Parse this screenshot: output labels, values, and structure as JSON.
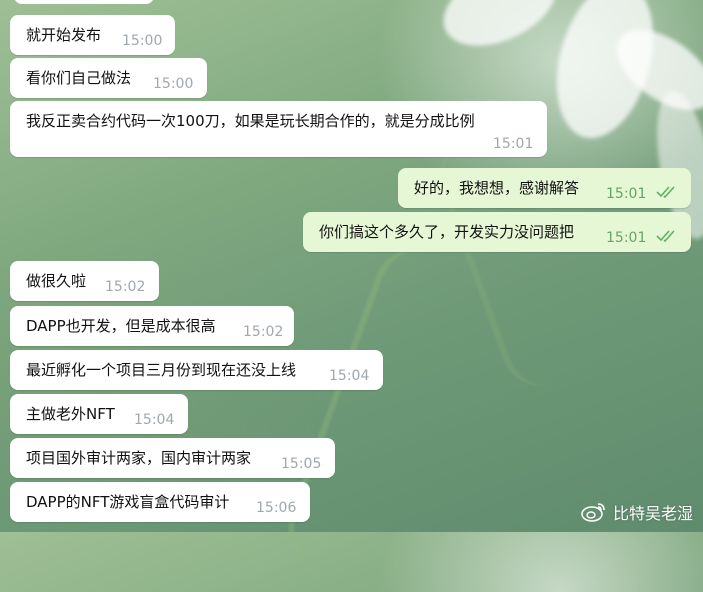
{
  "messages": [
    {
      "direction": "in",
      "text": "就开始发布",
      "time": "15:00"
    },
    {
      "direction": "in",
      "text": "看你们自己做法",
      "time": "15:00"
    },
    {
      "direction": "in",
      "text": "我反正卖合约代码一次100刀，如果是玩长期合作的，就是分成比例",
      "time": "15:01"
    },
    {
      "direction": "out",
      "text": "好的，我想想，感谢解答",
      "time": "15:01",
      "status": "read"
    },
    {
      "direction": "out",
      "text": "你们搞这个多久了，开发实力没问题把",
      "time": "15:01",
      "status": "read"
    },
    {
      "direction": "in",
      "text": "做很久啦",
      "time": "15:02"
    },
    {
      "direction": "in",
      "text": "DAPP也开发，但是成本很高",
      "time": "15:02"
    },
    {
      "direction": "in",
      "text": "最近孵化一个项目三月份到现在还没上线",
      "time": "15:04"
    },
    {
      "direction": "in",
      "text": "主做老外NFT",
      "time": "15:04"
    },
    {
      "direction": "in",
      "text": "项目国外审计两家，国内审计两家",
      "time": "15:05"
    },
    {
      "direction": "in",
      "text": "DAPP的NFT游戏盲盒代码审计",
      "time": "15:06"
    }
  ],
  "watermark": {
    "text": "比特吴老湿",
    "icon": "weibo-icon"
  },
  "colors": {
    "incoming_bubble": "#ffffff",
    "outgoing_bubble": "#e6f7d6",
    "read_ticks": "#5fb05f",
    "time_gray": "#a0a8ad"
  }
}
